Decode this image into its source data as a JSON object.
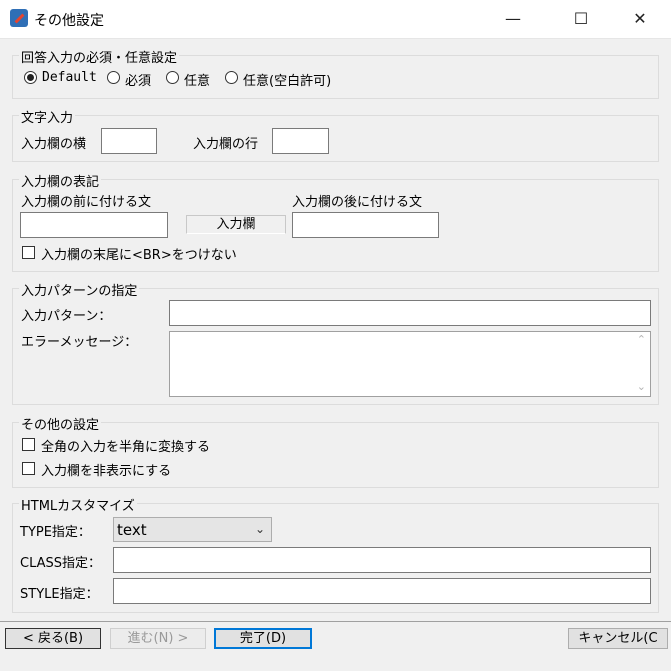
{
  "window": {
    "title": "その他設定",
    "icon": "app-icon",
    "controls": {
      "minimize": "—",
      "maximize": "☐",
      "close": "✕"
    }
  },
  "answer_required": {
    "legend": "回答入力の必須・任意設定",
    "options": [
      {
        "label": "Default",
        "selected": true
      },
      {
        "label": "必須",
        "selected": false
      },
      {
        "label": "任意",
        "selected": false
      },
      {
        "label": "任意(空白許可)",
        "selected": false
      }
    ]
  },
  "text_input": {
    "legend": "文字入力",
    "width_label": "入力欄の横",
    "width_value": "",
    "rows_label": "入力欄の行",
    "rows_value": ""
  },
  "display": {
    "legend": "入力欄の表記",
    "before_label": "入力欄の前に付ける文",
    "before_value": "",
    "preview_label": "入力欄",
    "after_label": "入力欄の後に付ける文",
    "after_value": "",
    "no_br_label": "入力欄の末尾に<BR>をつけない",
    "no_br_checked": false
  },
  "pattern": {
    "legend": "入力パターンの指定",
    "pattern_label": "入力パターン：",
    "pattern_value": "",
    "error_label": "エラーメッセージ：",
    "error_value": "",
    "scroll_up": "⌃",
    "scroll_down": "⌄"
  },
  "other": {
    "legend": "その他の設定",
    "convert_label": "全角の入力を半角に変換する",
    "convert_checked": false,
    "hide_label": "入力欄を非表示にする",
    "hide_checked": false
  },
  "html_custom": {
    "legend": "HTMLカスタマイズ",
    "type_label": "TYPE指定：",
    "type_value": "text",
    "class_label": "CLASS指定：",
    "class_value": "",
    "style_label": "STYLE指定：",
    "style_value": ""
  },
  "footer": {
    "back": "< 戻る(B)",
    "next": "進む(N) >",
    "finish": "完了(D)",
    "cancel": "キャンセル(C"
  }
}
